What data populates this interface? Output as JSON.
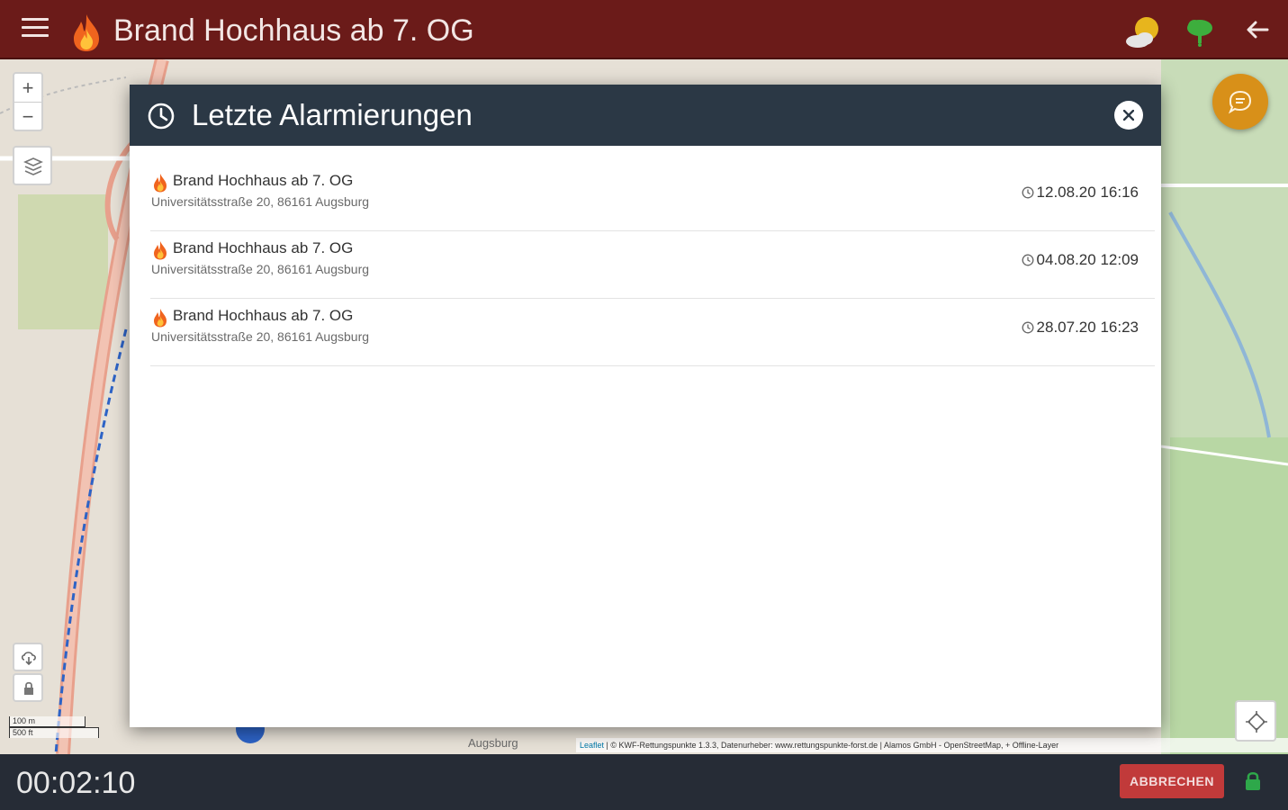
{
  "header": {
    "title": "Brand Hochhaus ab 7. OG",
    "menu_icon": "hamburger-menu-icon",
    "weather_icon": "sun-cloud-icon",
    "cloud_icon": "cloud-tree-icon",
    "back_icon": "arrow-left-icon",
    "accent": "#6b1b19"
  },
  "map": {
    "zoom_in": "+",
    "zoom_out": "−",
    "scale_m": "100 m",
    "scale_ft": "500 ft",
    "place_label": "Augsburg",
    "attribution_leaflet": "Leaflet",
    "attribution_text": " | © KWF-Rettungspunkte 1.3.3, Datenurheber: www.rettungspunkte-forst.de | Alamos GmbH - OpenStreetMap, + Offline-Layer"
  },
  "dialog": {
    "title": "Letzte Alarmierungen",
    "header_color": "#2b3845",
    "items": [
      {
        "title": "Brand Hochhaus ab 7. OG",
        "address": "Universitätsstraße 20, 86161 Augsburg",
        "time": "12.08.20 16:16"
      },
      {
        "title": "Brand Hochhaus ab 7. OG",
        "address": "Universitätsstraße 20, 86161 Augsburg",
        "time": "04.08.20 12:09"
      },
      {
        "title": "Brand Hochhaus ab 7. OG",
        "address": "Universitätsstraße 20, 86161 Augsburg",
        "time": "28.07.20 16:23"
      }
    ]
  },
  "footer": {
    "timer": "00:02:10",
    "abort_label": "ABBRECHEN",
    "abort_color": "#c13a3a",
    "lock_color": "#2ea84a"
  }
}
